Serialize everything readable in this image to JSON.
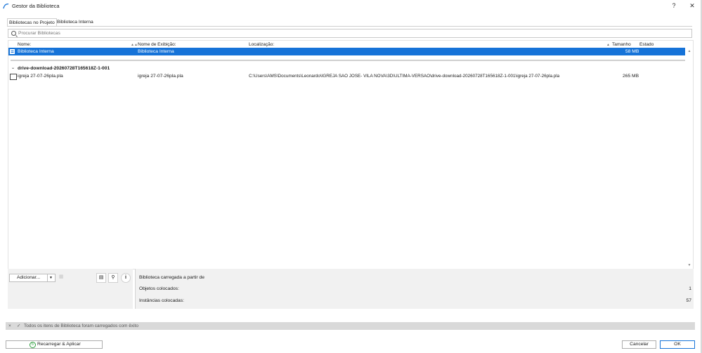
{
  "window": {
    "title": "Gestor da Biblioteca",
    "help": "?",
    "close": "✕"
  },
  "tabs": [
    {
      "label": "Bibliotecas no Projeto",
      "active": true
    },
    {
      "label": "Biblioteca Interna",
      "active": false
    }
  ],
  "search": {
    "placeholder": "Procurar Bibliotecas"
  },
  "columns": {
    "name": "Nome:",
    "display_name": "Nome de Exibição:",
    "location": "Localização:",
    "size": "Tamanho",
    "state": "Estado"
  },
  "selected_row": {
    "name": "Biblioteca Interna",
    "display_name": "Biblioteca Interna",
    "size": "58 MB"
  },
  "group": {
    "name": "drive-download-20260728T165618Z-1-001",
    "rows": [
      {
        "name": "igreja 27-07-26pla.pla",
        "display_name": "igreja 27-07-26pla.pla",
        "location": "C:\\Users\\AMS\\Documents\\Leonardo\\IGREJA SAO JOSE- VILA NOVA\\3D\\ULTIMA-VERSAO\\drive-download-20260728T165618Z-1-001\\igreja 27-07-26pla.pla",
        "size": "265 MB"
      }
    ]
  },
  "bottom": {
    "add_label": "Adicionar...",
    "loaded_from_label": "Biblioteca carregada a partir de",
    "placed_objects_label": "Objetos colocados:",
    "placed_objects_value": "1",
    "placed_instances_label": "Instâncias colocadas:",
    "placed_instances_value": "57"
  },
  "status": {
    "close": "×",
    "check": "✓",
    "message": "Todos os itens de Biblioteca foram carregados com êxito"
  },
  "footer": {
    "reload_label": "Recarregar & Aplicar",
    "cancel_label": "Cancelar",
    "ok_label": "OK"
  },
  "colors": {
    "selection": "#1673d8",
    "reload_icon": "#2a9d3a"
  }
}
